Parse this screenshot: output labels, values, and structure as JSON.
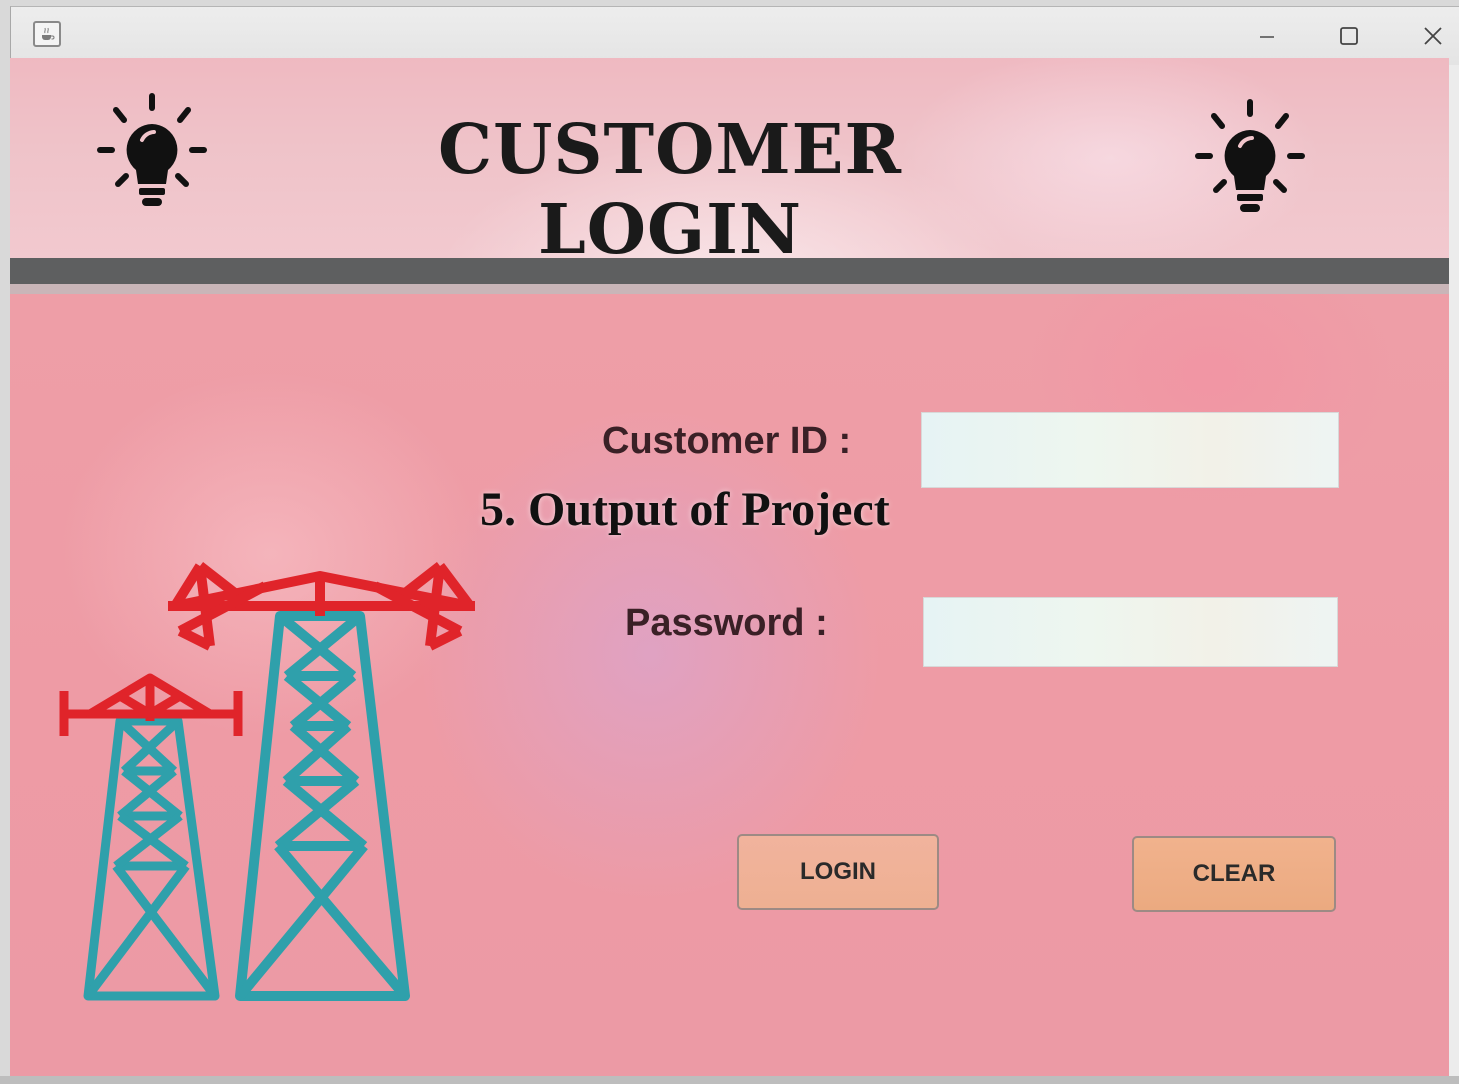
{
  "window": {
    "controls": {
      "minimize_glyph": "–",
      "maximize_glyph": "□",
      "close_glyph": "✕"
    },
    "app_icon": "java-cup-icon"
  },
  "header": {
    "title": "CUSTOMER LOGIN",
    "left_icon": "lightbulb-icon",
    "right_icon": "lightbulb-icon"
  },
  "form": {
    "customer_id_label": "Customer ID :",
    "customer_id_value": "",
    "password_label": "Password :",
    "password_value": ""
  },
  "buttons": {
    "login_label": "LOGIN",
    "clear_label": "CLEAR"
  },
  "overlay": {
    "caption": "5. Output of Project"
  },
  "illustration": {
    "icon": "power-transmission-towers-icon",
    "colors": {
      "crossarm": "#e0242a",
      "lattice": "#2fa0ab"
    }
  },
  "colors": {
    "panel_pink": "#ee9ea7",
    "header_pink": "#efc3c9",
    "divider": "#5e5f60",
    "login_button": "#f1b39d",
    "clear_button": "#eeab84"
  }
}
